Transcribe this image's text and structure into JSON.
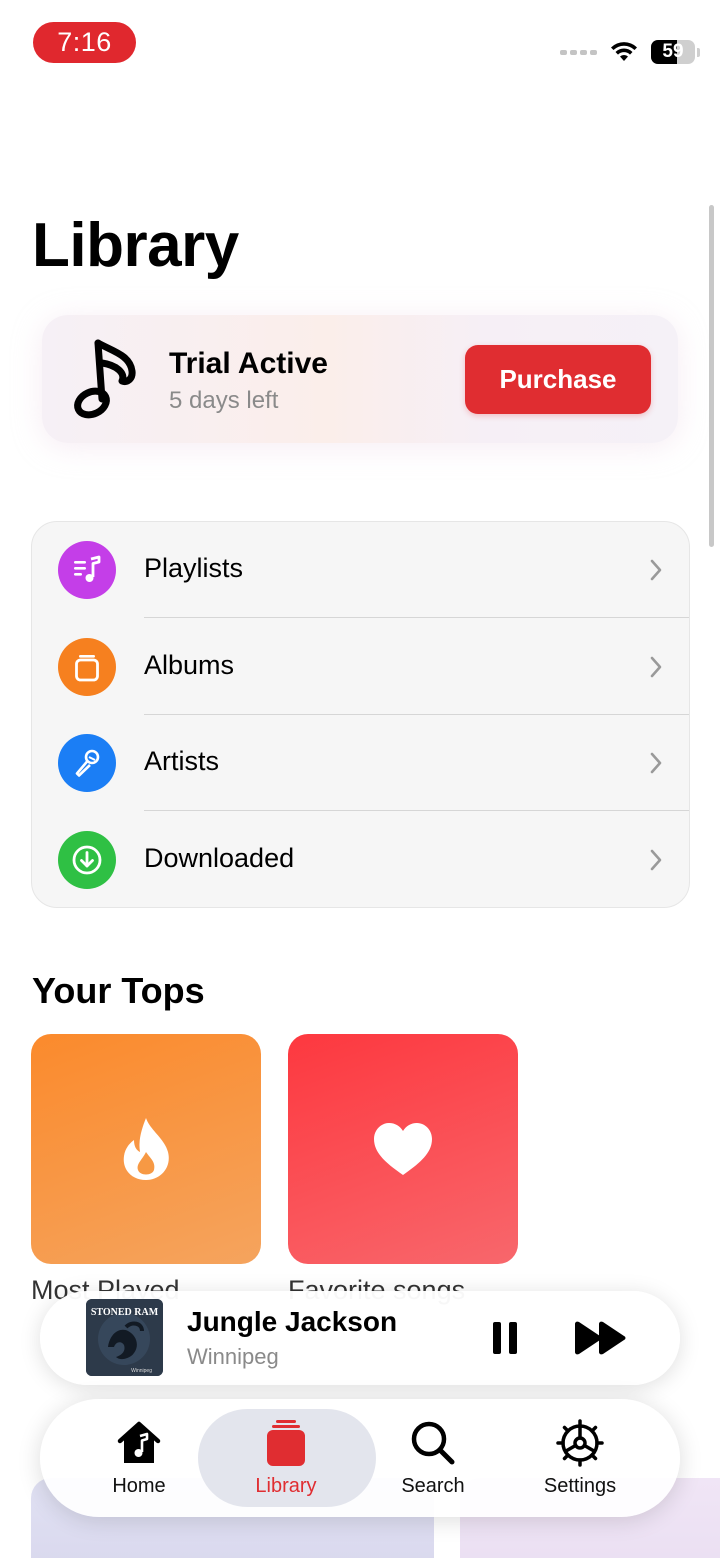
{
  "status_bar": {
    "time": "7:16",
    "battery": "59",
    "battery_level": 0.59
  },
  "page": {
    "title": "Library"
  },
  "trial": {
    "title": "Trial Active",
    "subtitle": "5 days left",
    "button_label": "Purchase"
  },
  "menu": {
    "items": [
      {
        "label": "Playlists",
        "icon": "playlist-icon",
        "color": "#c43ee8"
      },
      {
        "label": "Albums",
        "icon": "album-icon",
        "color": "#f6801f"
      },
      {
        "label": "Artists",
        "icon": "microphone-icon",
        "color": "#1b7ef5"
      },
      {
        "label": "Downloaded",
        "icon": "download-icon",
        "color": "#2fc044"
      }
    ]
  },
  "tops": {
    "title": "Your Tops",
    "tiles": [
      {
        "label": "Most Played",
        "icon": "flame-icon",
        "color": "#fb8a2c"
      },
      {
        "label": "Favorite songs",
        "icon": "heart-icon",
        "color": "#fd383f"
      }
    ]
  },
  "now_playing": {
    "title": "Jungle Jackson",
    "artist": "Winnipeg",
    "art_text": "STONED RAM",
    "art_subtext": "Winnipeg"
  },
  "tab_bar": {
    "tabs": [
      {
        "label": "Home",
        "icon": "home-music-icon"
      },
      {
        "label": "Library",
        "icon": "library-stack-icon",
        "active": true
      },
      {
        "label": "Search",
        "icon": "search-icon"
      },
      {
        "label": "Settings",
        "icon": "gear-icon"
      }
    ],
    "accent": "#e02d31"
  }
}
